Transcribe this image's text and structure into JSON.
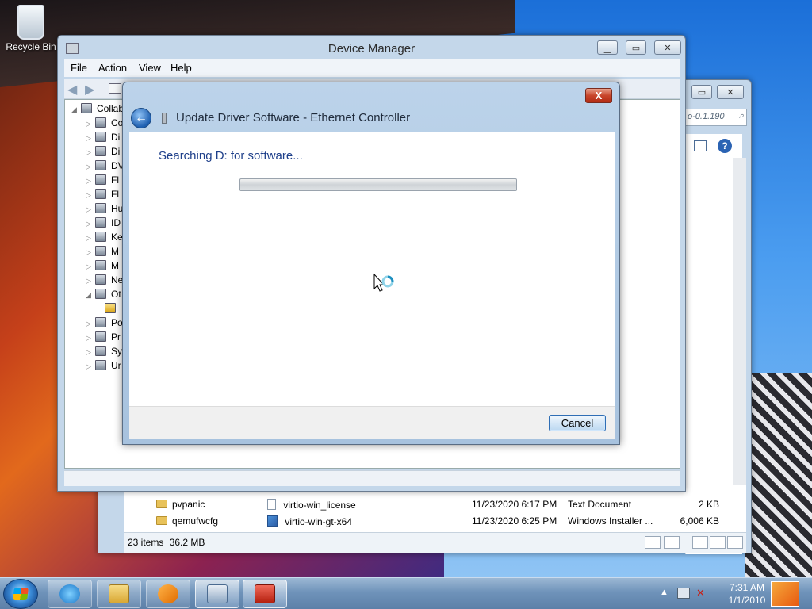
{
  "desktop": {
    "icons": [
      {
        "label": "Recycle Bin",
        "icon": "recycle-bin-icon"
      }
    ]
  },
  "explorer": {
    "search_placeholder": "o-0.1.190",
    "tree_items": [
      {
        "label": "pvpanic"
      },
      {
        "label": "qemufwcfg"
      }
    ],
    "files": [
      {
        "name": "virtio-win_license",
        "date": "11/23/2020 6:17 PM",
        "type": "Text Document",
        "size": "2 KB",
        "icon": "text-document-icon"
      },
      {
        "name": "virtio-win-gt-x64",
        "date": "11/23/2020 6:25 PM",
        "type": "Windows Installer ...",
        "size": "6,006 KB",
        "icon": "installer-icon"
      }
    ],
    "status": {
      "items": "23 items",
      "size": "36.2 MB"
    }
  },
  "device_manager": {
    "title": "Device Manager",
    "menu": [
      "File",
      "Action",
      "View",
      "Help"
    ],
    "tree_root": "Collab",
    "tree_items": [
      "Co",
      "Di",
      "Di",
      "DV",
      "Fl",
      "Fl",
      "Hu",
      "ID",
      "Ke",
      "M",
      "M",
      "Ne",
      "Ot",
      "",
      "Po",
      "Pr",
      "Sy",
      "Ur"
    ]
  },
  "dialog": {
    "title": "Update Driver Software - Ethernet Controller",
    "message": "Searching D: for software...",
    "progress": 0.0,
    "cancel_label": "Cancel",
    "close_glyph": "X"
  },
  "taskbar": {
    "pinned": [
      {
        "name": "internet-explorer-icon"
      },
      {
        "name": "windows-explorer-icon"
      },
      {
        "name": "media-player-icon"
      },
      {
        "name": "device-manager-icon"
      },
      {
        "name": "toolbox-icon"
      }
    ],
    "clock": {
      "time": "7:31 AM",
      "date": "1/1/2010"
    }
  },
  "colors": {
    "accent": "#1e3f8a",
    "progress_fill": "#40b42a",
    "close_red": "#c8452b"
  }
}
